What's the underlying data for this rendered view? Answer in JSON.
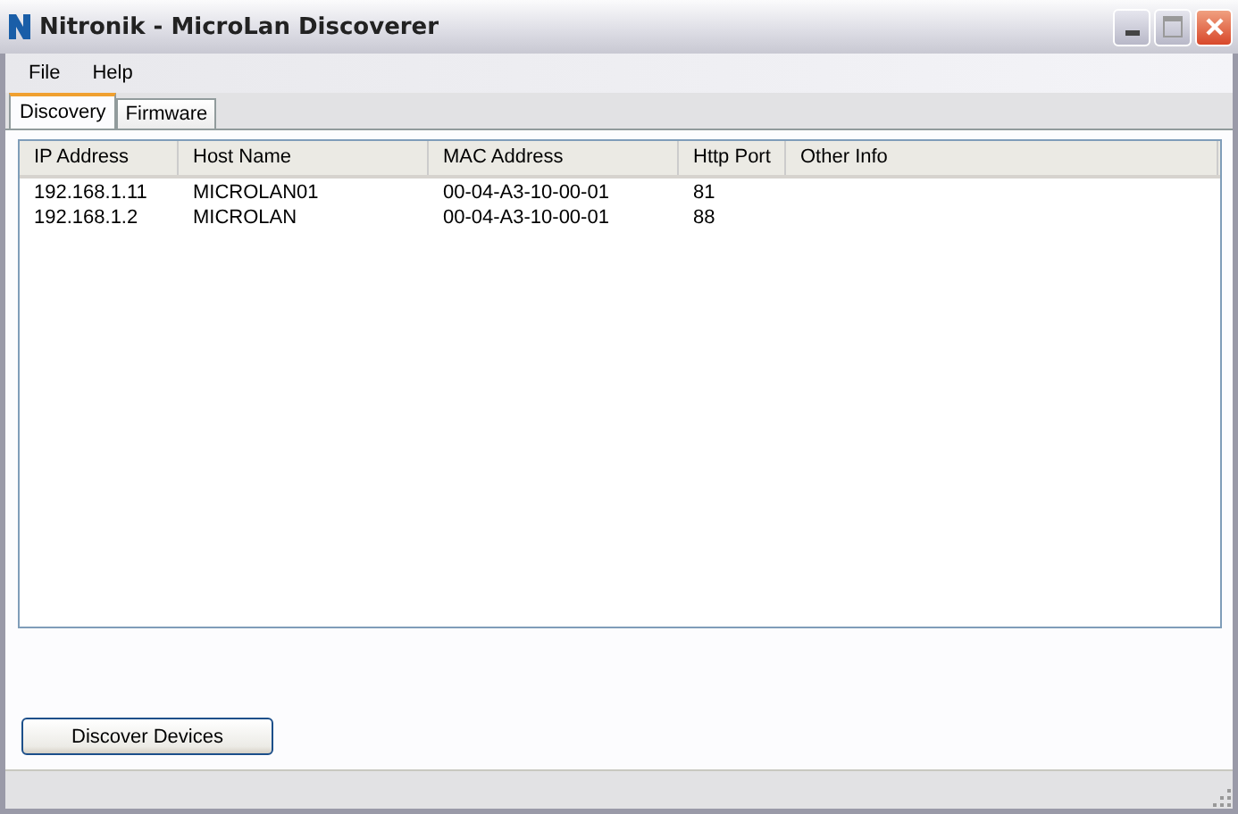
{
  "window": {
    "title": "Nitronik - MicroLan Discoverer"
  },
  "menu": [
    "File",
    "Help"
  ],
  "tabs": [
    {
      "label": "Discovery",
      "selected": true
    },
    {
      "label": "Firmware",
      "selected": false
    }
  ],
  "table": {
    "columns": [
      "IP Address",
      "Host Name",
      "MAC Address",
      "Http Port",
      "Other Info"
    ],
    "rows": [
      [
        "192.168.1.11",
        "MICROLAN01",
        "00-04-A3-10-00-01",
        "81"
      ],
      [
        "192.168.1.2",
        "MICROLAN",
        "00-04-A3-10-00-01",
        "88"
      ]
    ]
  },
  "buttons": [
    "Discover Devices"
  ]
}
